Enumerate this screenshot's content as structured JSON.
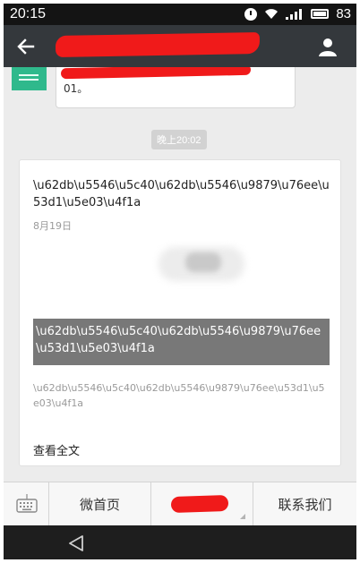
{
  "status_bar": {
    "time": "20:15",
    "battery": "83",
    "icons": [
      "alarm-icon",
      "wifi-icon",
      "signal-icon",
      "battery-icon"
    ]
  },
  "nav": {
    "back_icon": "arrow-left-icon",
    "profile_icon": "person-icon"
  },
  "chat": {
    "previous_message_tail": "01。",
    "time_separator": "晚上20:02",
    "card": {
      "title": "\\u62db\\u5546\\u5c40\\u62db\\u5546\\u9879\\u76ee\\u53d1\\u5e03\\u4f1a",
      "date": "8月19日",
      "cover_caption": "\\u62db\\u5546\\u5c40\\u62db\\u5546\\u9879\\u76ee\\u53d1\\u5e03\\u4f1a",
      "digest": "\\u62db\\u5546\\u5c40\\u62db\\u5546\\u9879\\u76ee\\u53d1\\u5e03\\u4f1a",
      "read_more": "查看全文"
    }
  },
  "bottom_menu": {
    "keyboard_icon": "keyboard-icon",
    "items": [
      {
        "label": "微首页"
      },
      {
        "label": ""
      },
      {
        "label": "联系我们"
      }
    ]
  },
  "system_nav": {
    "back_icon": "triangle-back-icon"
  },
  "colors": {
    "nav_bar": "#34383c",
    "chat_background": "#ececec",
    "redaction": "#f01a1a",
    "cover_caption_bg": "#787878"
  }
}
